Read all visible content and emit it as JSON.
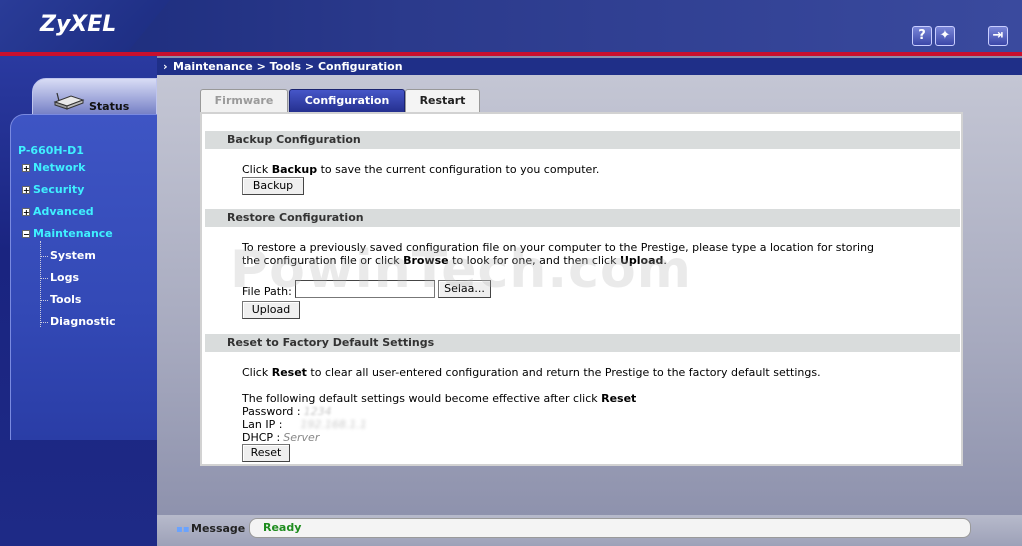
{
  "header": {
    "brand": "ZyXEL",
    "help_icon": "question-icon",
    "wizard_icon": "wizard-icon",
    "logout_icon": "logout-icon"
  },
  "breadcrumb": "Maintenance > Tools > Configuration",
  "sidebar": {
    "status_label": "Status",
    "device": "P-660H-D1",
    "items": [
      {
        "label": "Network",
        "state": "+"
      },
      {
        "label": "Security",
        "state": "+"
      },
      {
        "label": "Advanced",
        "state": "+"
      },
      {
        "label": "Maintenance",
        "state": "-"
      }
    ],
    "subitems": [
      "System",
      "Logs",
      "Tools",
      "Diagnostic"
    ]
  },
  "tabs": [
    "Firmware",
    "Configuration",
    "Restart"
  ],
  "backup": {
    "title": "Backup Configuration",
    "text_pre": "Click ",
    "text_bold": "Backup",
    "text_post": " to save the current configuration to you computer.",
    "button": "Backup"
  },
  "restore": {
    "title": "Restore Configuration",
    "line1": "To restore a previously saved configuration file on your computer to the Prestige, please type a location for storing",
    "line2_pre": "the configuration file or click ",
    "line2_browse": "Browse",
    "line2_mid": " to look for one, and then click ",
    "line2_upload": "Upload",
    "line2_post": ".",
    "file_label": "File Path:",
    "file_value": "",
    "browse_button": "Selaa...",
    "upload_button": "Upload"
  },
  "reset": {
    "title": "Reset to Factory Default Settings",
    "line1_pre": "Click ",
    "line1_bold": "Reset",
    "line1_post": " to clear all user-entered configuration and return the Prestige to the factory default settings.",
    "line2_pre": "The following default settings would become effective after click ",
    "line2_bold": "Reset",
    "password_label": "Password :",
    "password_value": "1234",
    "lanip_label": "Lan IP :",
    "lanip_value": "192.168.1.1",
    "dhcp_label": "DHCP :",
    "dhcp_value": "Server",
    "button": "Reset"
  },
  "watermark": "PowinTech.com",
  "message": {
    "label": "Message",
    "value": "Ready"
  }
}
